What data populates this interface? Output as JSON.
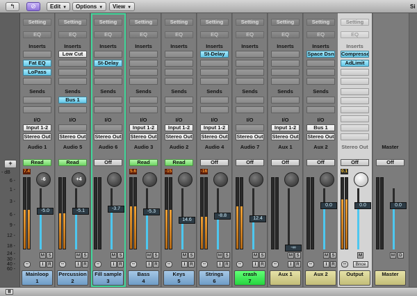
{
  "toolbar": {
    "back_icon": "back-arrow-icon",
    "link_icon": "link-icon",
    "menus": [
      {
        "label": "Edit"
      },
      {
        "label": "Options"
      },
      {
        "label": "View"
      }
    ],
    "right_cut": "Si"
  },
  "left": {
    "plus": "+",
    "db": "- dB",
    "scale": [
      "6 -",
      "1 -",
      "3 -",
      "6 -",
      "9 -",
      "12 -",
      "18 -",
      "24 -",
      "30 -",
      "40 -",
      "60 -"
    ]
  },
  "strips": [
    {
      "setting": "Setting",
      "eq": "EQ",
      "inserts_label": "Inserts",
      "inserts": [
        "",
        "Fat EQ",
        "LoPass",
        ""
      ],
      "sends_label": "Sends",
      "sends": [
        "",
        ""
      ],
      "io_label": "I/O",
      "input": "Input 1-2",
      "output": "Stereo Out",
      "group": "Audio 1",
      "automation": "Read",
      "peak": "7.4",
      "pan": "-6",
      "fader": "-5.0",
      "fader_level": 0.62,
      "meter_level": 0.55,
      "name_line1": "Mainloop",
      "name_line2": "1",
      "color": "blue"
    },
    {
      "setting": "Setting",
      "eq": "EQ",
      "inserts_label": "Inserts",
      "inserts": [
        "Low Cut",
        "",
        "",
        ""
      ],
      "sends_label": "Sends",
      "sends": [
        "Bus 1",
        ""
      ],
      "io_label": "I/O",
      "input": "",
      "output": "Stereo Out",
      "group": "Audio 5",
      "automation": "Read",
      "peak": "",
      "pan": "+4",
      "fader": "-5.1",
      "fader_level": 0.62,
      "meter_level": 0.5,
      "name_line1": "Percussion",
      "name_line2": "2",
      "color": "blue"
    },
    {
      "setting": "Setting",
      "eq": "EQ",
      "inserts_label": "Inserts",
      "inserts": [
        "",
        "St-Delay",
        "",
        ""
      ],
      "sends_label": "Sends",
      "sends": [
        "",
        ""
      ],
      "io_label": "I/O",
      "input": "",
      "output": "Stereo Out",
      "group": "Audio 6",
      "automation": "Off",
      "peak": "",
      "pan": "",
      "fader": "-3.7",
      "fader_level": 0.66,
      "meter_level": 0.0,
      "name_line1": "Fill sample",
      "name_line2": "3",
      "color": "blue"
    },
    {
      "setting": "Setting",
      "eq": "EQ",
      "inserts_label": "Inserts",
      "inserts": [
        "",
        "",
        "",
        ""
      ],
      "sends_label": "Sends",
      "sends": [
        "",
        ""
      ],
      "io_label": "I/O",
      "input": "Input 1-2",
      "output": "Stereo Out",
      "group": "Audio 3",
      "automation": "Read",
      "peak": "5.6",
      "pan": "",
      "fader": "-5.3",
      "fader_level": 0.61,
      "meter_level": 0.6,
      "name_line1": "Bass",
      "name_line2": "4",
      "color": "blue"
    },
    {
      "setting": "Setting",
      "eq": "EQ",
      "inserts_label": "Inserts",
      "inserts": [
        "",
        "",
        "",
        ""
      ],
      "sends_label": "Sends",
      "sends": [
        "",
        ""
      ],
      "io_label": "I/O",
      "input": "Input 1-2",
      "output": "Stereo Out",
      "group": "Audio 2",
      "automation": "Read",
      "peak": "-15",
      "pan": "",
      "fader": "14.6",
      "fader_level": 0.48,
      "meter_level": 0.55,
      "name_line1": "Keys",
      "name_line2": "5",
      "color": "blue"
    },
    {
      "setting": "Setting",
      "eq": "EQ",
      "inserts_label": "Inserts",
      "inserts": [
        "St-Delay",
        "",
        "",
        ""
      ],
      "sends_label": "Sends",
      "sends": [
        "",
        ""
      ],
      "io_label": "I/O",
      "input": "Input 1-2",
      "output": "Stereo Out",
      "group": "Audio 4",
      "automation": "Off",
      "peak": "-16",
      "pan": "",
      "fader": "-8.8",
      "fader_level": 0.55,
      "meter_level": 0.45,
      "name_line1": "Strings",
      "name_line2": "6",
      "color": "blue"
    },
    {
      "setting": "Setting",
      "eq": "EQ",
      "inserts_label": "Inserts",
      "inserts": [
        "",
        "",
        "",
        ""
      ],
      "sends_label": "Sends",
      "sends": [
        "",
        ""
      ],
      "io_label": "I/O",
      "input": "",
      "output": "Stereo Out",
      "group": "Audio 7",
      "automation": "Off",
      "peak": "",
      "pan": "",
      "fader": "12.4",
      "fader_level": 0.5,
      "meter_level": 0.6,
      "name_line1": "crash",
      "name_line2": "7",
      "color": "green"
    },
    {
      "setting": "Setting",
      "eq": "EQ",
      "inserts_label": "Inserts",
      "inserts": [
        "",
        "",
        "",
        ""
      ],
      "sends_label": "Sends",
      "sends": [
        "",
        ""
      ],
      "io_label": "I/O",
      "input": "Input 1-2",
      "output": "Stereo Out",
      "group": "Aux 1",
      "automation": "Off",
      "peak": "",
      "pan": "",
      "fader": "-∞",
      "fader_level": 0.02,
      "meter_level": 0.0,
      "name_line1": "Aux 1",
      "name_line2": "",
      "color": "olive"
    },
    {
      "setting": "Setting",
      "eq": "EQ",
      "inserts_label": "Inserts",
      "inserts": [
        "Space Dsn",
        "",
        "",
        ""
      ],
      "sends_label": "Sends",
      "sends": [
        "",
        ""
      ],
      "io_label": "I/O",
      "input": "Bus 1",
      "output": "Stereo Out",
      "group": "Aux 2",
      "automation": "Off",
      "peak": "",
      "pan": "",
      "fader": "0.0",
      "fader_level": 0.72,
      "meter_level": 0.0,
      "name_line1": "Aux 2",
      "name_line2": "",
      "color": "olive"
    },
    {
      "setting": "Setting",
      "eq": "EQ",
      "inserts_label": "Inserts",
      "inserts": [
        "Compresso",
        "AdLimit",
        "",
        ""
      ],
      "sends_label": "",
      "sends": [],
      "io_label": "",
      "input": "",
      "output": "",
      "group": "Stereo Out",
      "automation": "Off",
      "peak": "0.1",
      "pan": "",
      "fader": "0.0",
      "fader_level": 0.72,
      "meter_level": 0.7,
      "name_line1": "Output",
      "name_line2": "",
      "color": "olive",
      "bnce": "Bnce",
      "light": true
    },
    {
      "setting": "",
      "eq": "",
      "inserts_label": "",
      "inserts": [],
      "sends_label": "",
      "sends": [],
      "io_label": "",
      "input": "",
      "output": "",
      "group": "Master",
      "automation": "Off",
      "peak": "",
      "pan": "",
      "fader": "0.0",
      "fader_level": 0.72,
      "meter_level": 0.0,
      "name_line1": "Master",
      "name_line2": "",
      "color": "olive",
      "master": true
    }
  ],
  "colors": {
    "blue": "#8db6dd",
    "green": "#3ae656",
    "olive": "#d6d290",
    "selection": "#41d69a"
  }
}
